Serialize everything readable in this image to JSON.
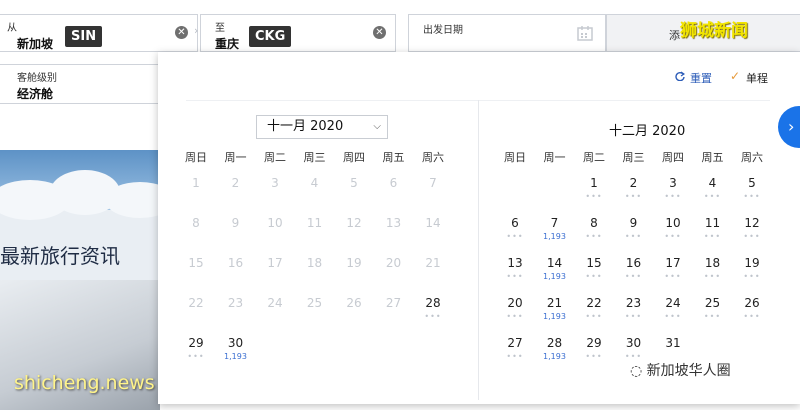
{
  "search": {
    "origin": {
      "label": "从",
      "city": "新加坡",
      "code": "SIN"
    },
    "destination": {
      "label": "至",
      "city": "重庆",
      "code": "CKG"
    },
    "depart_label": "出发日期",
    "add_return_partial": "添",
    "cabin": {
      "label": "客舱级别",
      "value": "经济舱"
    }
  },
  "calendar": {
    "reset_label": "重置",
    "oneway_label": "单程",
    "weekdays": [
      "周日",
      "周一",
      "周二",
      "周三",
      "周四",
      "周五",
      "周六"
    ],
    "nov": {
      "title": "十一月 2020",
      "days": [
        {
          "d": "1",
          "s": "dis"
        },
        {
          "d": "2",
          "s": "dis"
        },
        {
          "d": "3",
          "s": "dis"
        },
        {
          "d": "4",
          "s": "dis"
        },
        {
          "d": "5",
          "s": "dis"
        },
        {
          "d": "6",
          "s": "dis"
        },
        {
          "d": "7",
          "s": "dis"
        },
        {
          "d": "8",
          "s": "dis"
        },
        {
          "d": "9",
          "s": "dis"
        },
        {
          "d": "10",
          "s": "dis"
        },
        {
          "d": "11",
          "s": "dis"
        },
        {
          "d": "12",
          "s": "dis"
        },
        {
          "d": "13",
          "s": "dis"
        },
        {
          "d": "14",
          "s": "dis"
        },
        {
          "d": "15",
          "s": "dis"
        },
        {
          "d": "16",
          "s": "dis"
        },
        {
          "d": "17",
          "s": "dis"
        },
        {
          "d": "18",
          "s": "dis"
        },
        {
          "d": "19",
          "s": "dis"
        },
        {
          "d": "20",
          "s": "dis"
        },
        {
          "d": "21",
          "s": "dis"
        },
        {
          "d": "22",
          "s": "dis"
        },
        {
          "d": "23",
          "s": "dis"
        },
        {
          "d": "24",
          "s": "dis"
        },
        {
          "d": "25",
          "s": "dis"
        },
        {
          "d": "26",
          "s": "dis"
        },
        {
          "d": "27",
          "s": "dis"
        },
        {
          "d": "28",
          "s": "en",
          "sub": "•••"
        },
        {
          "d": "29",
          "s": "en",
          "sub": "•••"
        },
        {
          "d": "30",
          "s": "en",
          "sub": "1,193",
          "price": true
        }
      ]
    },
    "dec": {
      "title": "十二月 2020",
      "offset": 2,
      "days": [
        {
          "d": "1",
          "sub": "•••"
        },
        {
          "d": "2",
          "sub": "•••"
        },
        {
          "d": "3",
          "sub": "•••"
        },
        {
          "d": "4",
          "sub": "•••"
        },
        {
          "d": "5",
          "sub": "•••"
        },
        {
          "d": "6",
          "sub": "•••"
        },
        {
          "d": "7",
          "sub": "1,193",
          "price": true
        },
        {
          "d": "8",
          "sub": "•••"
        },
        {
          "d": "9",
          "sub": "•••"
        },
        {
          "d": "10",
          "sub": "•••"
        },
        {
          "d": "11",
          "sub": "•••"
        },
        {
          "d": "12",
          "sub": "•••"
        },
        {
          "d": "13",
          "sub": "•••"
        },
        {
          "d": "14",
          "sub": "1,193",
          "price": true
        },
        {
          "d": "15",
          "sub": "•••"
        },
        {
          "d": "16",
          "sub": "•••"
        },
        {
          "d": "17",
          "sub": "•••"
        },
        {
          "d": "18",
          "sub": "•••"
        },
        {
          "d": "19",
          "sub": "•••"
        },
        {
          "d": "20",
          "sub": "•••"
        },
        {
          "d": "21",
          "sub": "1,193",
          "price": true
        },
        {
          "d": "22",
          "sub": "•••"
        },
        {
          "d": "23",
          "sub": "•••"
        },
        {
          "d": "24",
          "sub": "•••"
        },
        {
          "d": "25",
          "sub": "•••"
        },
        {
          "d": "26",
          "sub": "•••"
        },
        {
          "d": "27",
          "sub": "•••"
        },
        {
          "d": "28",
          "sub": "1,193",
          "price": true
        },
        {
          "d": "29",
          "sub": "•••"
        },
        {
          "d": "30",
          "sub": "•••"
        },
        {
          "d": "31"
        }
      ]
    }
  },
  "background": {
    "news_text": "最新旅行资讯"
  },
  "watermarks": {
    "top_right": "狮城新闻",
    "bottom_left": "shicheng.news",
    "bottom_right": "新加坡华人圈"
  }
}
